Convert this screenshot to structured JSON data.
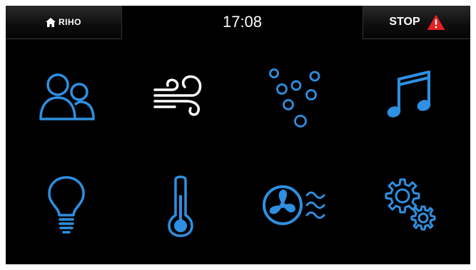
{
  "topbar": {
    "home_label": "RIHO",
    "time": "17:08",
    "stop_label": "STOP"
  },
  "colors": {
    "background": "#000000",
    "icon_blue": "#2f8fe0",
    "icon_white": "#ffffff",
    "warning_red": "#e52222"
  },
  "tiles": [
    {
      "icon": "users-icon"
    },
    {
      "icon": "wind-icon"
    },
    {
      "icon": "bubbles-icon"
    },
    {
      "icon": "music-icon"
    },
    {
      "icon": "lightbulb-icon"
    },
    {
      "icon": "thermometer-icon"
    },
    {
      "icon": "fan-icon"
    },
    {
      "icon": "settings-gears-icon"
    }
  ]
}
